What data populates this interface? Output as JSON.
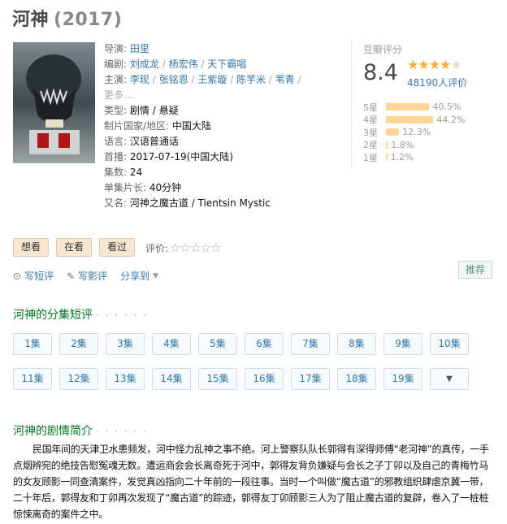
{
  "title": {
    "name": "河神",
    "year": "(2017)"
  },
  "info": {
    "director_label": "导演:",
    "director": "田里",
    "writer_label": "编剧:",
    "writers": [
      "刘成龙",
      "杨宏伟",
      "天下霸唱"
    ],
    "cast_label": "主演:",
    "cast": [
      "李现",
      "张铭恩",
      "王紫璇",
      "陈芋米",
      "苇青"
    ],
    "cast_more": "更多...",
    "genre_label": "类型:",
    "genres": [
      "剧情",
      "悬疑"
    ],
    "country_label": "制片国家/地区:",
    "country": "中国大陆",
    "language_label": "语言:",
    "language": "汉语普通话",
    "premiere_label": "首播:",
    "premiere": "2017-07-19(中国大陆)",
    "episodes_label": "集数:",
    "episodes": "24",
    "runtime_label": "单集片长:",
    "runtime": "40分钟",
    "aka_label": "又名:",
    "aka": "河神之魔古道 / Tientsin Mystic"
  },
  "rating": {
    "label": "豆瓣评分",
    "score": "8.4",
    "stars": 4,
    "votes": "48190人评价",
    "breakdown": [
      {
        "label": "5星",
        "percent": "40.5%",
        "value": 40.5
      },
      {
        "label": "4星",
        "percent": "44.2%",
        "value": 44.2
      },
      {
        "label": "3星",
        "percent": "12.3%",
        "value": 12.3
      },
      {
        "label": "2星",
        "percent": "1.8%",
        "value": 1.8
      },
      {
        "label": "1星",
        "percent": "1.2%",
        "value": 1.2
      }
    ]
  },
  "actions": {
    "wish": "想看",
    "doing": "在看",
    "collect": "看过",
    "rate_label": "评价:"
  },
  "share": {
    "short_review": "写短评",
    "review": "写影评",
    "share": "分享到",
    "recommend": "推荐"
  },
  "episodes_section": {
    "title": "河神的分集短评",
    "dots": "· · · · · ·",
    "items": [
      "1集",
      "2集",
      "3集",
      "4集",
      "5集",
      "6集",
      "7集",
      "8集",
      "9集",
      "10集",
      "11集",
      "12集",
      "13集",
      "14集",
      "15集",
      "16集",
      "17集",
      "18集",
      "19集"
    ]
  },
  "plot_section": {
    "title": "河神的剧情简介",
    "dots": "· · · · · ·",
    "text": "民国年间的天津卫水患频发，河中怪力乱神之事不绝。河上警察队队长郭得有深得师傅“老河神”的真传，一手点烟辨宛的绝技告慰冤魂无数。遭运商会会长离奇死于河中，郭得友背负嫌疑与会长之子丁卯以及自己的青梅竹马的女友顾影一同查清案件，发觉真凶指向二十年前的一段往事。当时一个叫做“魔古道”的邪教组织肆虐京冀一带，二十年后，郭得友和丁卯再次发现了“魔古道”的踪迹，郭得友丁卯顾影三人为了阻止魔古道的复辟，卷入了一桩桩惊悚离奇的案件之中。"
  }
}
